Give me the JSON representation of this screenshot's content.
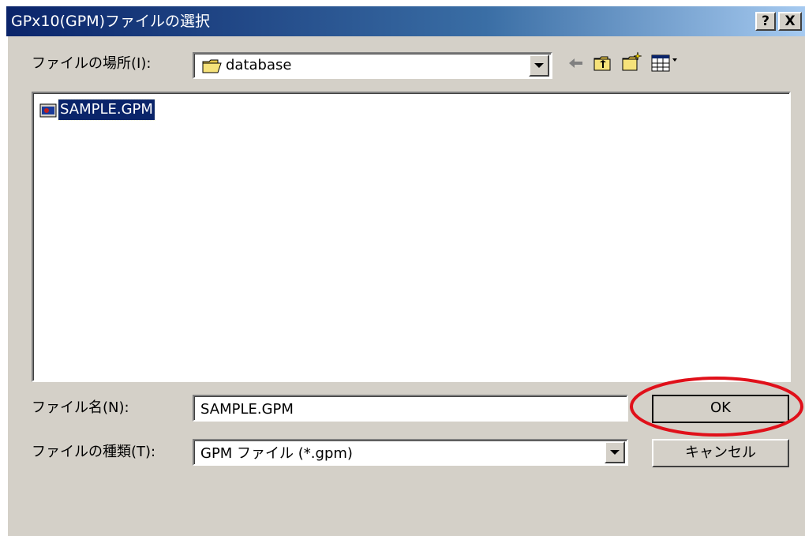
{
  "window": {
    "title": "GPx10(GPM)ファイルの選択",
    "help_label": "?",
    "close_label": "X"
  },
  "lookin": {
    "label": "ファイルの場所(I):",
    "value": "database"
  },
  "toolbar": {
    "icons": [
      "back-arrow-icon",
      "up-folder-icon",
      "new-folder-icon",
      "view-menu-icon"
    ]
  },
  "files": [
    {
      "name": "SAMPLE.GPM",
      "icon": "gpm-file-icon",
      "selected": true
    }
  ],
  "filename": {
    "label": "ファイル名(N):",
    "value": "SAMPLE.GPM"
  },
  "filetype": {
    "label": "ファイルの種類(T):",
    "value": "GPM ファイル (*.gpm)"
  },
  "buttons": {
    "ok": "OK",
    "cancel": "キャンセル"
  },
  "colors": {
    "highlight_circle": "#e0101a",
    "selection": "#0a246a",
    "dialog_face": "#d4d0c8"
  }
}
